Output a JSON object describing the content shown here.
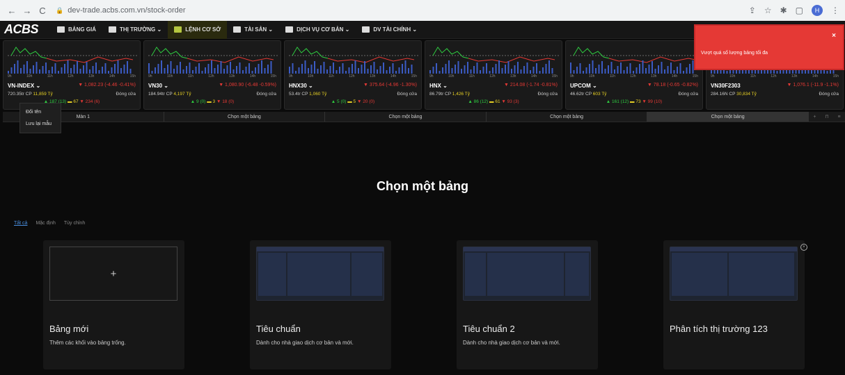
{
  "browser": {
    "url": "dev-trade.acbs.com.vn/stock-order",
    "profile_initial": "H"
  },
  "nav": {
    "logo": "ACBS",
    "items": [
      "BẢNG GIÁ",
      "THỊ TRƯỜNG ⌄",
      "LỆNH CƠ SỞ",
      "TÀI SẢN ⌄",
      "DỊCH VỤ CƠ BẢN ⌄",
      "DV TÀI CHÍNH ⌄"
    ]
  },
  "indices": [
    {
      "name": "VN-INDEX ⌄",
      "change": "▼ 1,082.23 (-4.46 -0.41%)",
      "volume": "720.35tr CP",
      "value": "11,859 Tỷ",
      "status": "Đóng cửa",
      "breadth_up": "▲ 187 (13)",
      "breadth_flat": "▬ 67",
      "breadth_down": "▼ 234 (6)"
    },
    {
      "name": "VN30 ⌄",
      "change": "▼ 1,080.90 (-6.48 -0.59%)",
      "volume": "184.94tr CP",
      "value": "4,197 Tỷ",
      "status": "Đóng cửa",
      "breadth_up": "▲ 9 (0)",
      "breadth_flat": "▬ 3",
      "breadth_down": "▼ 18 (0)"
    },
    {
      "name": "HNX30 ⌄",
      "change": "▼ 375.64 (-4.96 -1.30%)",
      "volume": "53.4tr CP",
      "value": "1,060 Tỷ",
      "status": "Đóng cửa",
      "breadth_up": "▲ 5 (0)",
      "breadth_flat": "▬ 5",
      "breadth_down": "▼ 20 (0)"
    },
    {
      "name": "HNX ⌄",
      "change": "▼ 214.08 (-1.74 -0.81%)",
      "volume": "86.79tr CP",
      "value": "1,426 Tỷ",
      "status": "Đóng cửa",
      "breadth_up": "▲ 86 (12)",
      "breadth_flat": "▬ 61",
      "breadth_down": "▼ 93 (3)"
    },
    {
      "name": "UPCOM ⌄",
      "change": "▼ 78.18 (-0.65 -0.82%)",
      "volume": "46.62tr CP",
      "value": "603 Tỷ",
      "status": "Đóng cửa",
      "breadth_up": "▲ 161 (12)",
      "breadth_flat": "▬ 73",
      "breadth_down": "▼ 99 (10)"
    },
    {
      "name": "VN30F2303",
      "change": "▼ 1,076.1 (-11.9 -1.1%)",
      "volume": "284.16N CP",
      "value": "30,834 Tỷ",
      "status": "Đóng cửa",
      "breadth_up": "",
      "breadth_flat": "",
      "breadth_down": ""
    }
  ],
  "time_ticks": [
    "9h",
    "10h",
    "11h",
    "12h",
    "13h",
    "14h",
    "15h"
  ],
  "context_menu": [
    "Đổi tên",
    "Lưu lại mẫu"
  ],
  "tabs": [
    "Màn 1",
    "Chọn một bảng",
    "Chọn một bảng",
    "Chọn một bảng",
    "Chọn một bảng"
  ],
  "toast": {
    "message": "Vượt quá số lượng bảng tối đa",
    "close": "×"
  },
  "main": {
    "title": "Chọn một bảng",
    "filters": [
      "Tất cả",
      "Mặc định",
      "Tùy chỉnh"
    ]
  },
  "cards": [
    {
      "title": "Bảng mới",
      "desc": "Thêm các khối vào bảng trống.",
      "plus": "+"
    },
    {
      "title": "Tiêu chuẩn",
      "desc": "Dành cho nhà giao dịch cơ bản và mới."
    },
    {
      "title": "Tiêu chuẩn 2",
      "desc": "Dành cho nhà giao dịch cơ bản và mới."
    },
    {
      "title": "Phân tích thị trường 123",
      "desc": ""
    }
  ]
}
